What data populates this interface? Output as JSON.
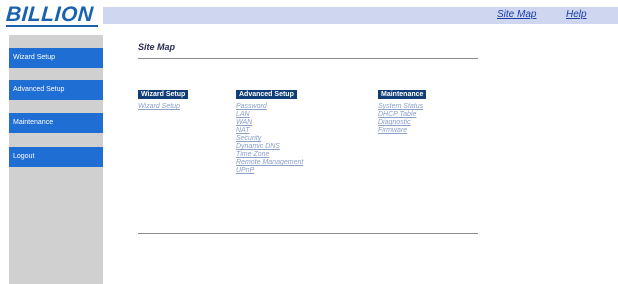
{
  "header": {
    "logo_text": "BILLION",
    "site_map_link": "Site Map",
    "help_link": "Help",
    "band_color": "#ced6f0"
  },
  "sidebar": {
    "items": [
      {
        "label": "Wizard Setup"
      },
      {
        "label": "Advanced Setup"
      },
      {
        "label": "Maintenance"
      },
      {
        "label": "Logout"
      }
    ]
  },
  "main": {
    "title": "Site Map",
    "columns": [
      {
        "heading": "Wizard Setup",
        "links": [
          "Wizard Setup"
        ]
      },
      {
        "heading": "Advanced Setup",
        "links": [
          "Password",
          "LAN",
          "WAN",
          "NAT",
          "Security",
          "Dynamic DNS",
          "Time Zone",
          "Remote Management",
          "UPnP"
        ]
      },
      {
        "heading": "Maintenance",
        "links": [
          "System Status",
          "DHCP Table",
          "Diagnostic",
          "Firmware"
        ]
      }
    ]
  },
  "colors": {
    "nav_blue": "#1e6ed4",
    "heading_navy": "#123e78",
    "link_color": "#8aa0c8",
    "logo_blue": "#1a62b0"
  }
}
